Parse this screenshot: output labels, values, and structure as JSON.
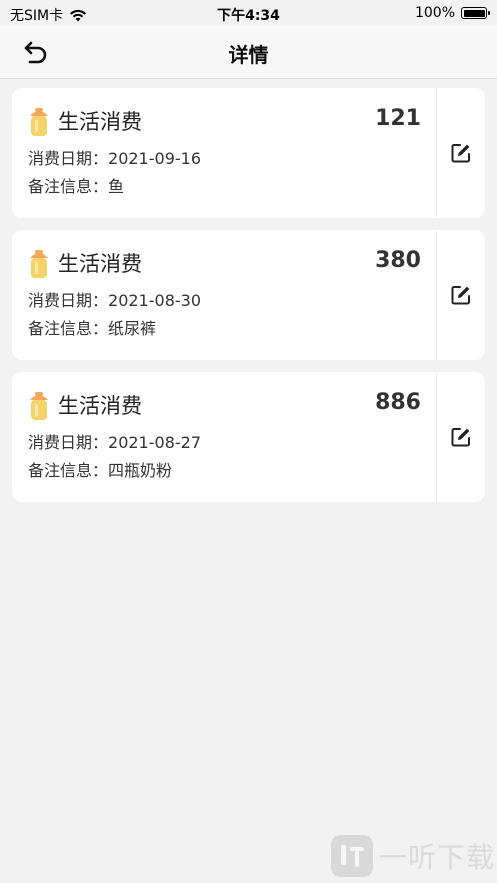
{
  "status_bar": {
    "carrier": "无SIM卡",
    "time": "下午4:34",
    "battery": "100%"
  },
  "nav": {
    "title": "详情",
    "back_icon": "back-arrow-icon"
  },
  "records": [
    {
      "category": "生活消费",
      "amount": "121",
      "date_label": "消费日期：",
      "date": "2021-09-16",
      "note_label": "备注信息：",
      "note": "鱼"
    },
    {
      "category": "生活消费",
      "amount": "380",
      "date_label": "消费日期：",
      "date": "2021-08-30",
      "note_label": "备注信息：",
      "note": "纸尿裤"
    },
    {
      "category": "生活消费",
      "amount": "886",
      "date_label": "消费日期：",
      "date": "2021-08-27",
      "note_label": "备注信息：",
      "note": "四瓶奶粉"
    }
  ],
  "watermark": {
    "text": "一听下载"
  },
  "colors": {
    "background": "#f2f2f2",
    "card": "#ffffff",
    "icon_cap": "#f4a95a",
    "icon_bottle": "#f5d36b"
  }
}
